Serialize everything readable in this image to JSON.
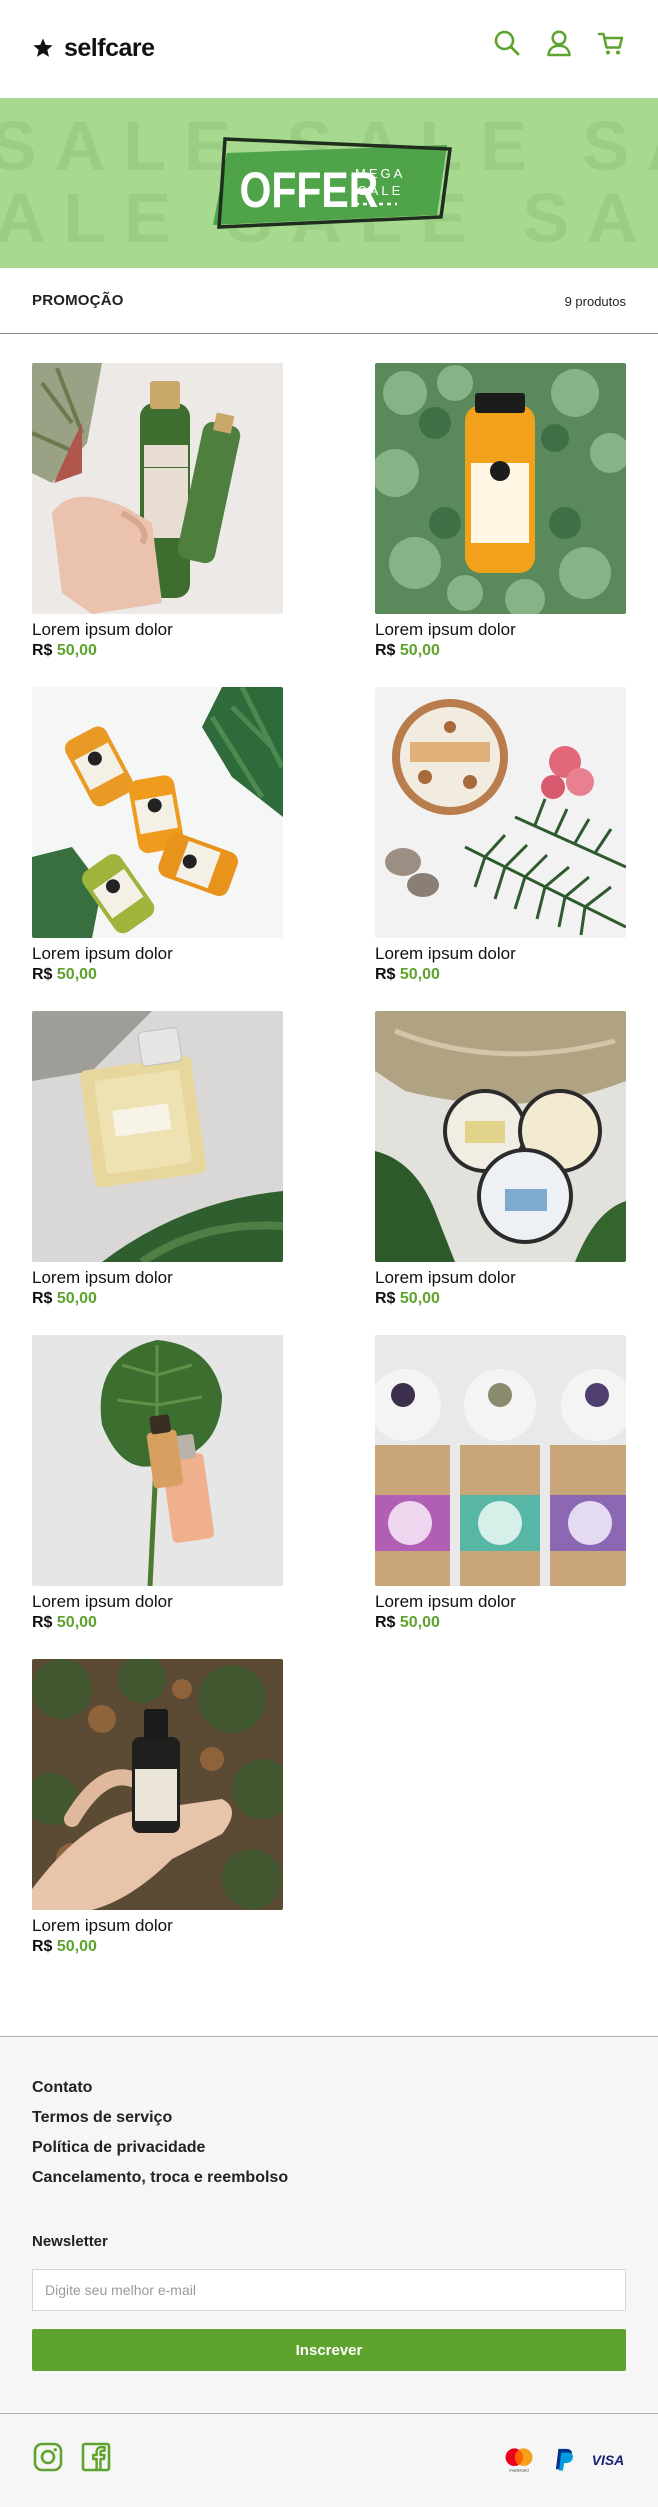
{
  "header": {
    "brand_name": "selfcare",
    "icons": [
      "star-icon",
      "search-icon",
      "user-icon",
      "cart-icon"
    ]
  },
  "banner": {
    "background_text": "SALE SALE SALE SALE",
    "offer_text": "OFFER",
    "mega_text": "MEGA",
    "sale_text": "SALE",
    "accent_color": "#5ea32d",
    "bg_color": "#a7d98f"
  },
  "section": {
    "title": "PROMOÇÃO",
    "count": "9 produtos"
  },
  "products": [
    {
      "name": "Lorem ipsum dolor",
      "currency": "R$",
      "price": "50,00",
      "image": "green-shampoo-bottle"
    },
    {
      "name": "Lorem ipsum dolor",
      "currency": "R$",
      "price": "50,00",
      "image": "orange-juice-bottle-leaves"
    },
    {
      "name": "Lorem ipsum dolor",
      "currency": "R$",
      "price": "50,00",
      "image": "orange-shot-bottles"
    },
    {
      "name": "Lorem ipsum dolor",
      "currency": "R$",
      "price": "50,00",
      "image": "cosmetic-tin-fern"
    },
    {
      "name": "Lorem ipsum dolor",
      "currency": "R$",
      "price": "50,00",
      "image": "perfume-bottle"
    },
    {
      "name": "Lorem ipsum dolor",
      "currency": "R$",
      "price": "50,00",
      "image": "cream-tins-bag"
    },
    {
      "name": "Lorem ipsum dolor",
      "currency": "R$",
      "price": "50,00",
      "image": "leaf-serum-bottle"
    },
    {
      "name": "Lorem ipsum dolor",
      "currency": "R$",
      "price": "50,00",
      "image": "bath-bombs-boxes"
    },
    {
      "name": "Lorem ipsum dolor",
      "currency": "R$",
      "price": "50,00",
      "image": "hand-dropper-bottle"
    }
  ],
  "footer": {
    "links": [
      "Contato",
      "Termos de serviço",
      "Política de privacidade",
      "Cancelamento, troca e reembolso"
    ],
    "newsletter_title": "Newsletter",
    "email_placeholder": "Digite seu melhor e-mail",
    "subscribe_label": "Inscrever",
    "social_icons": [
      "instagram-icon",
      "facebook-icon"
    ],
    "payment_icons": [
      "mastercard-icon",
      "paypal-icon",
      "visa-icon"
    ],
    "mastercard_caption": "mastercard",
    "visa_text": "VISA"
  }
}
